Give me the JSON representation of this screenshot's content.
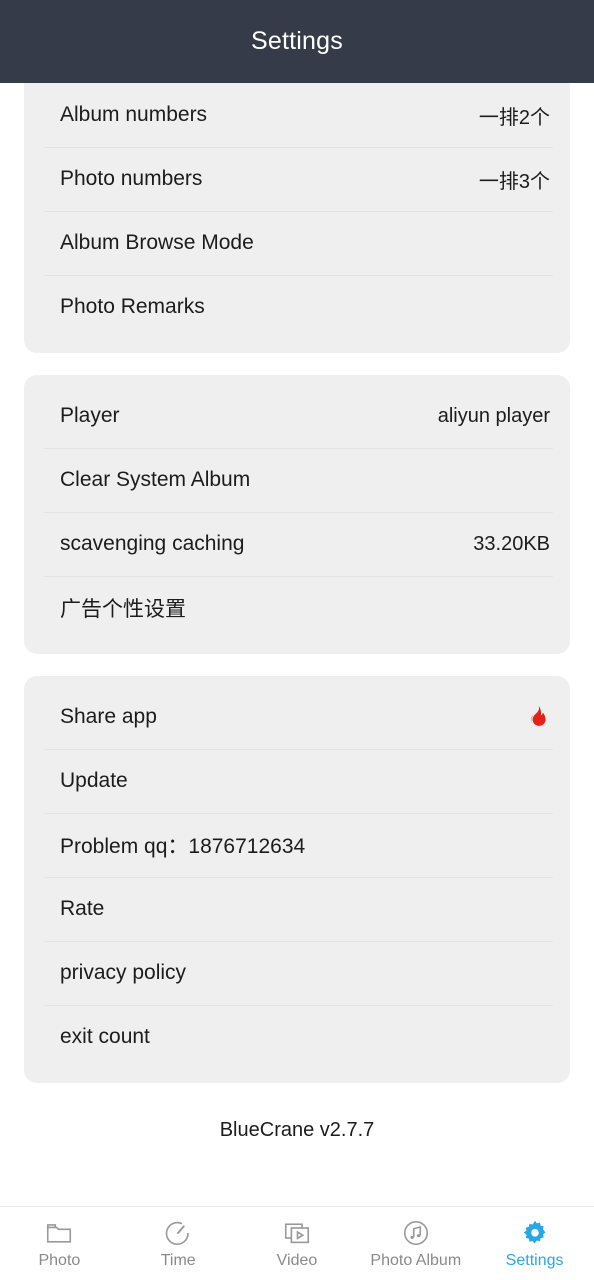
{
  "header": {
    "title": "Settings",
    "bg_color": "#353b48",
    "text_color": "#ffffff"
  },
  "theme": {
    "card_bg": "#efefef",
    "page_bg": "#ffffff",
    "accent": "#29a6e8",
    "flame_color": "#e32219",
    "divider": "#e4e4e4",
    "inactive_tab": "#8a8a8a"
  },
  "sections": [
    {
      "id": "display-section",
      "rows": [
        {
          "name": "album-numbers",
          "label": "Album numbers",
          "value": "一排2个"
        },
        {
          "name": "photo-numbers",
          "label": "Photo numbers",
          "value": "一排3个"
        },
        {
          "name": "album-browse-mode",
          "label": "Album Browse Mode",
          "value": ""
        },
        {
          "name": "photo-remarks",
          "label": "Photo Remarks",
          "value": ""
        }
      ]
    },
    {
      "id": "playback-section",
      "rows": [
        {
          "name": "player",
          "label": "Player",
          "value": "aliyun player"
        },
        {
          "name": "clear-system-album",
          "label": "Clear System Album",
          "value": ""
        },
        {
          "name": "scavenging-caching",
          "label": "scavenging caching",
          "value": "33.20KB"
        },
        {
          "name": "ad-personalization",
          "label": "广告个性设置",
          "value": ""
        }
      ]
    },
    {
      "id": "about-section",
      "rows": [
        {
          "name": "share-app",
          "label": "Share app",
          "value": "",
          "icon": "flame-icon"
        },
        {
          "name": "update",
          "label": "Update",
          "value": ""
        },
        {
          "name": "problem-qq",
          "label": "Problem qq：1876712634",
          "value": ""
        },
        {
          "name": "rate",
          "label": "Rate",
          "value": ""
        },
        {
          "name": "privacy-policy",
          "label": "privacy policy",
          "value": ""
        },
        {
          "name": "exit-count",
          "label": "exit count",
          "value": ""
        }
      ]
    }
  ],
  "version": "BlueCrane v2.7.7",
  "tabbar": {
    "items": [
      {
        "name": "photo",
        "label": "Photo",
        "icon": "folder-icon",
        "active": false
      },
      {
        "name": "time",
        "label": "Time",
        "icon": "stopwatch-icon",
        "active": false
      },
      {
        "name": "video",
        "label": "Video",
        "icon": "video-stack-icon",
        "active": false
      },
      {
        "name": "photo-album",
        "label": "Photo Album",
        "icon": "music-note-circle-icon",
        "active": false
      },
      {
        "name": "settings",
        "label": "Settings",
        "icon": "gear-icon",
        "active": true
      }
    ]
  }
}
